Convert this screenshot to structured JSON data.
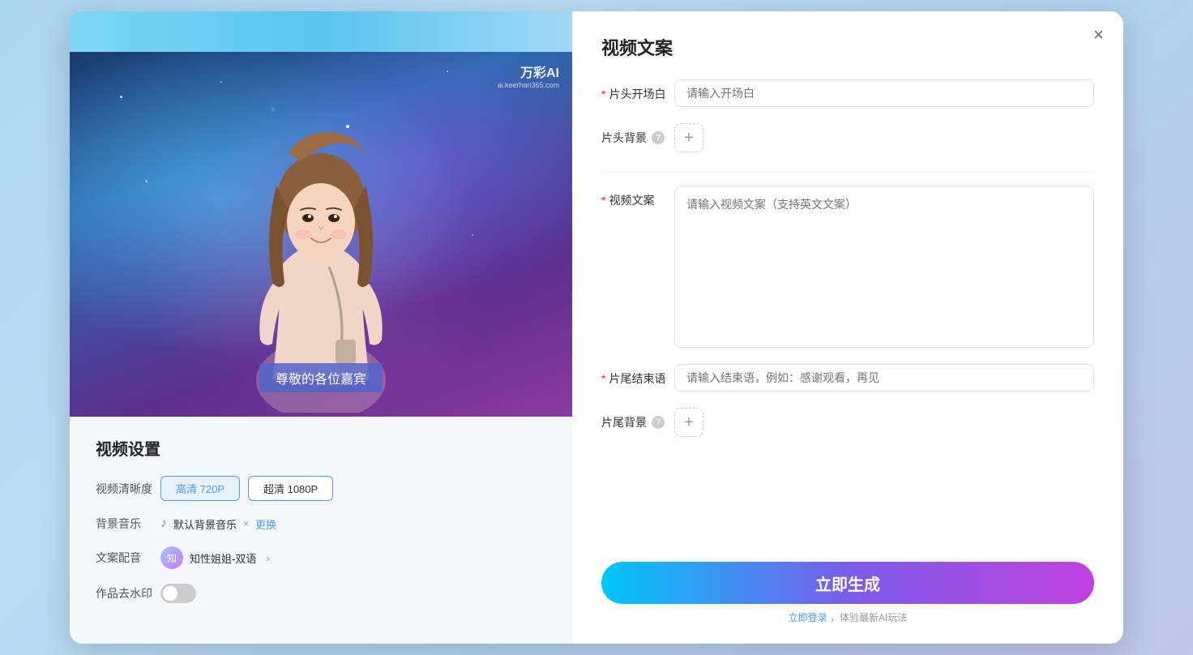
{
  "modal": {
    "close_label": "×"
  },
  "left": {
    "watermark_text": "万彩AI",
    "watermark_sub": "ai.keerhan365.com",
    "subtitle": "尊敬的各位嘉宾",
    "settings_title": "视频设置",
    "video_quality_label": "视频清晰度",
    "quality_options": [
      {
        "label": "高清 720P",
        "active": true
      },
      {
        "label": "超清 1080P",
        "active": false
      }
    ],
    "music_label": "背景音乐",
    "music_name": "默认背景音乐",
    "music_change": "更换",
    "voice_label": "文案配音",
    "voice_name": "知性姐姐-双语",
    "watermark_label": "作品去水印"
  },
  "right": {
    "title": "视频文案",
    "opening_label": "片头开场白",
    "opening_required": "*",
    "opening_placeholder": "请输入开场白",
    "header_bg_label": "片头背景",
    "video_script_label": "视频文案",
    "video_script_required": "*",
    "video_script_placeholder": "请输入视频文案（支持英文文案）",
    "ending_label": "片尾结束语",
    "ending_required": "*",
    "ending_placeholder": "请输入结束语，例如：感谢观看，再见",
    "footer_bg_label": "片尾背景",
    "generate_btn": "立即生成",
    "login_hint": "立即登录，体验最新AI玩法"
  }
}
